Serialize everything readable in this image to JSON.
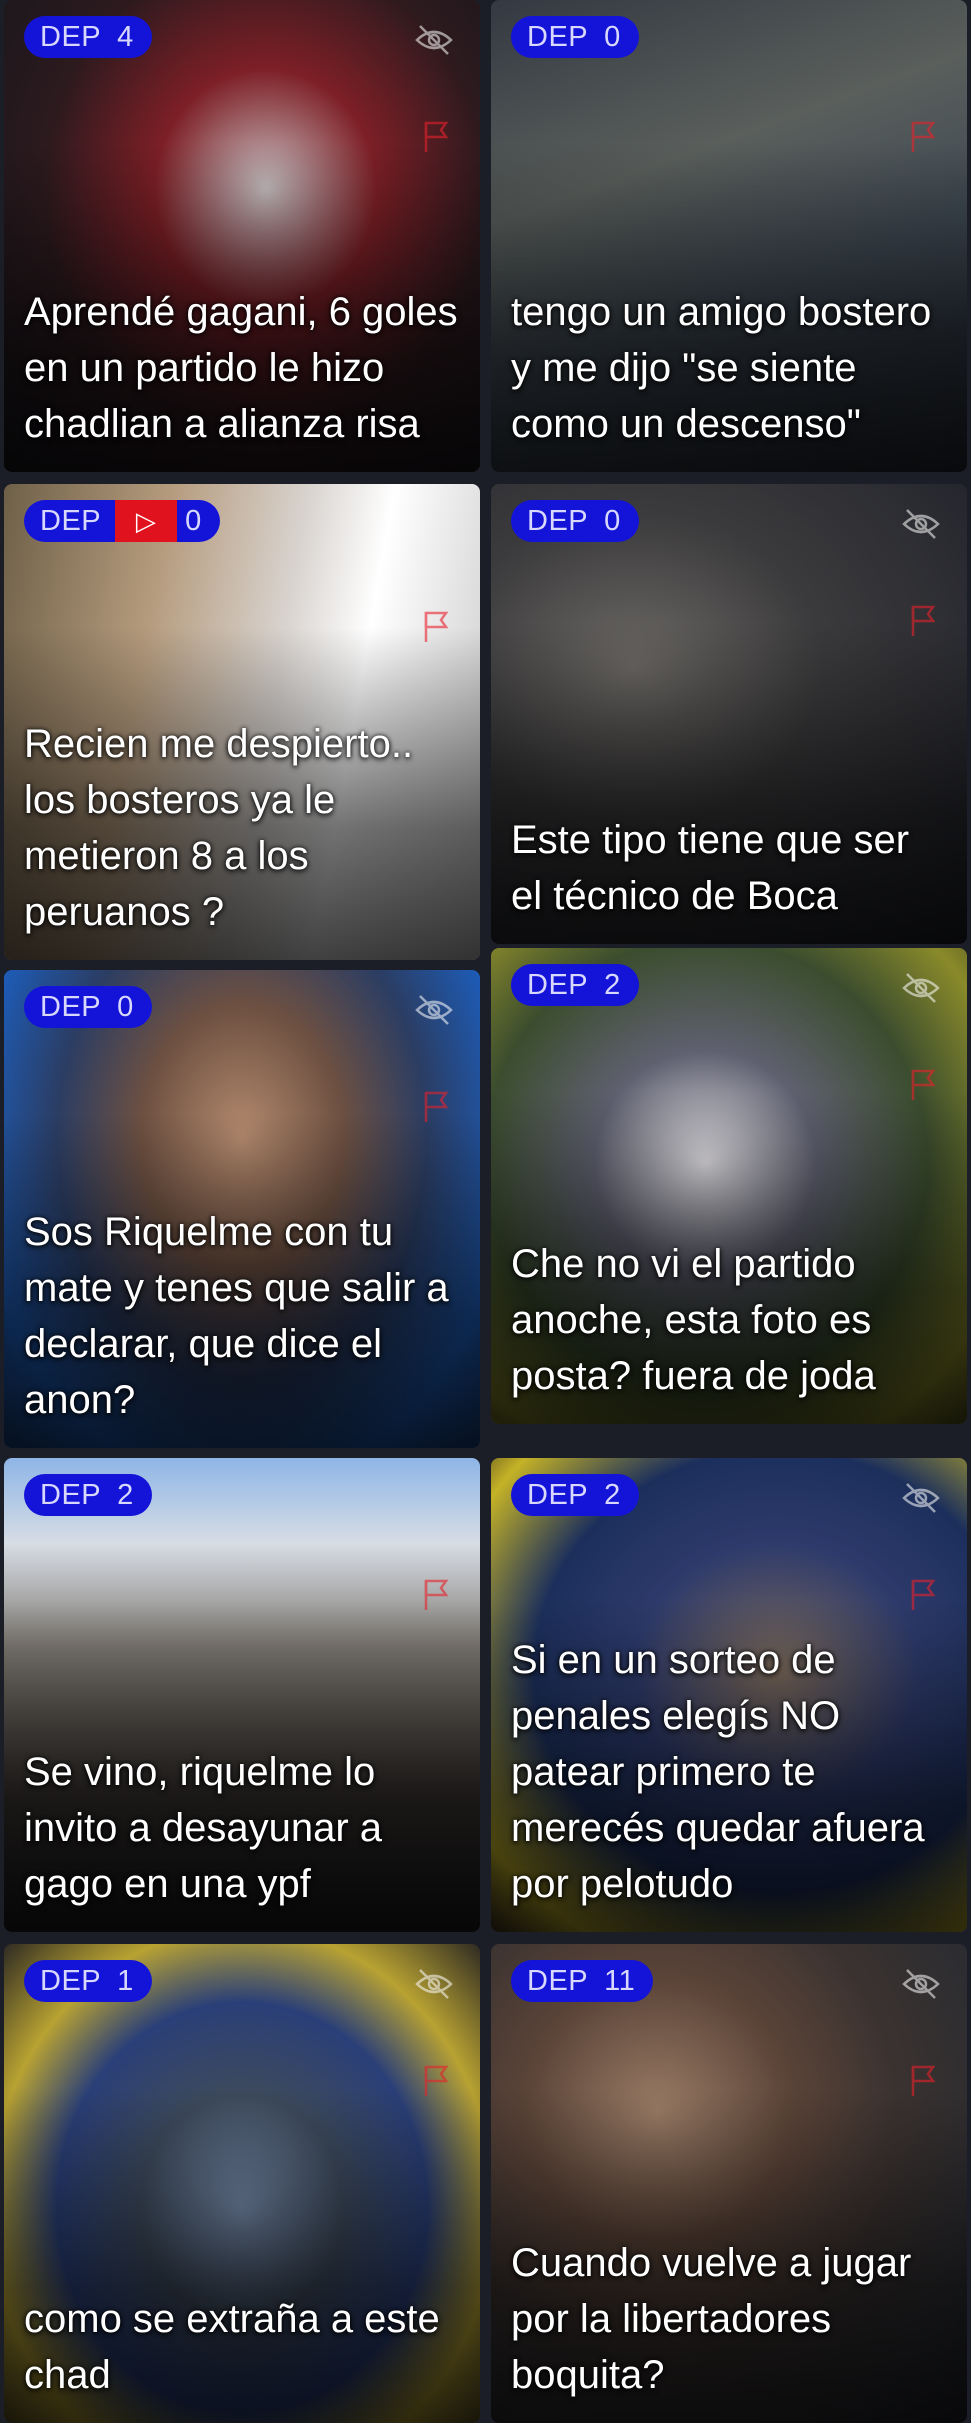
{
  "feed": {
    "cards": [
      {
        "badge_label": "DEP",
        "count": "4",
        "has_video": false,
        "title": "Aprendé gagani, 6 goles en un partido le hizo chadlian a alianza risa"
      },
      {
        "badge_label": "DEP",
        "count": "0",
        "has_video": false,
        "title": "tengo un amigo bostero y me dijo \"se siente como un descenso\""
      },
      {
        "badge_label": "DEP",
        "count": "0",
        "has_video": true,
        "title": "Recien me despierto.. los bosteros ya le metieron 8 a los peruanos ?"
      },
      {
        "badge_label": "DEP",
        "count": "0",
        "has_video": false,
        "title": "Este tipo tiene que ser el técnico de Boca"
      },
      {
        "badge_label": "DEP",
        "count": "0",
        "has_video": false,
        "title": "Sos Riquelme con tu mate y tenes que salir a declarar, que dice el anon?"
      },
      {
        "badge_label": "DEP",
        "count": "2",
        "has_video": false,
        "title": "Che no vi el partido anoche, esta foto es posta? fuera de joda"
      },
      {
        "badge_label": "DEP",
        "count": "2",
        "has_video": false,
        "title": "Se vino, riquelme lo invito a desayunar a gago en una ypf"
      },
      {
        "badge_label": "DEP",
        "count": "2",
        "has_video": false,
        "title": "Si en un sorteo de penales elegís NO patear primero te merecés quedar afuera por pelotudo"
      },
      {
        "badge_label": "DEP",
        "count": "1",
        "has_video": false,
        "title": "como se extraña a este chad"
      },
      {
        "badge_label": "DEP",
        "count": "11",
        "has_video": false,
        "title": "Cuando vuelve a jugar por la libertadores boquita?"
      }
    ]
  },
  "icons": {
    "hide": "eye-slash-icon",
    "report": "flag-icon",
    "video": "play-icon"
  },
  "colors": {
    "background": "#1b1d27",
    "badge": "#1414d9",
    "video_badge": "#e0121e"
  }
}
